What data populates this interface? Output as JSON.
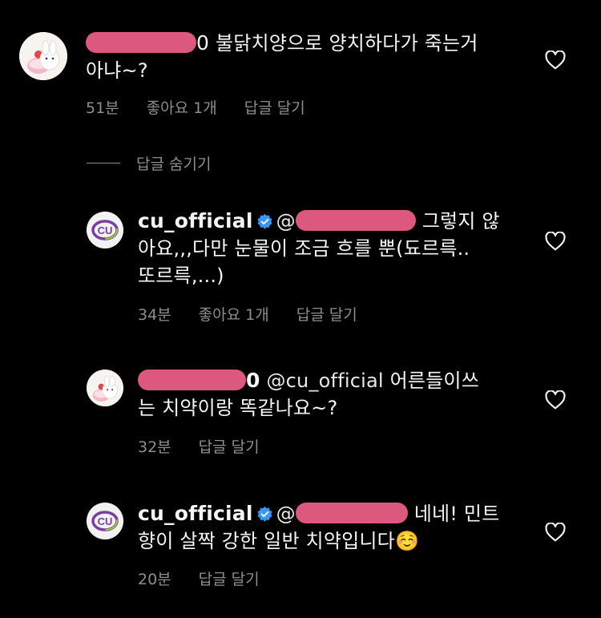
{
  "comments": [
    {
      "username_tail": "0",
      "text_line1": "불닭치양으로 양치하다가 죽는거",
      "text_line2": "아냐~?",
      "time": "51분",
      "likes": "좋아요 1개",
      "reply": "답글 달기"
    },
    {
      "username": "cu_official",
      "mention": "@",
      "text_line1_tail": "그렇지 않",
      "text_line2": "아요,,,다만 눈물이 조금 흐를 뿐(됴르륵..",
      "text_line3": "또르륵,...)",
      "time": "34분",
      "likes": "좋아요 1개",
      "reply": "답글 달기"
    },
    {
      "username_tail": "0",
      "mention": "@cu_official",
      "text_line1_tail": "어른들이쓰",
      "text_line2": "는 치약이랑 똑같나요~?",
      "time": "32분",
      "reply": "답글 달기"
    },
    {
      "username": "cu_official",
      "mention": "@",
      "text_line1_tail": "네네! 민트",
      "text_line2": "향이 살짝 강한 일반 치약입니다",
      "emoji": "☺️",
      "time": "20분",
      "reply": "답글 달기"
    }
  ],
  "hide_replies_label": "답글 숨기기",
  "avatar_cu_text": "CU"
}
